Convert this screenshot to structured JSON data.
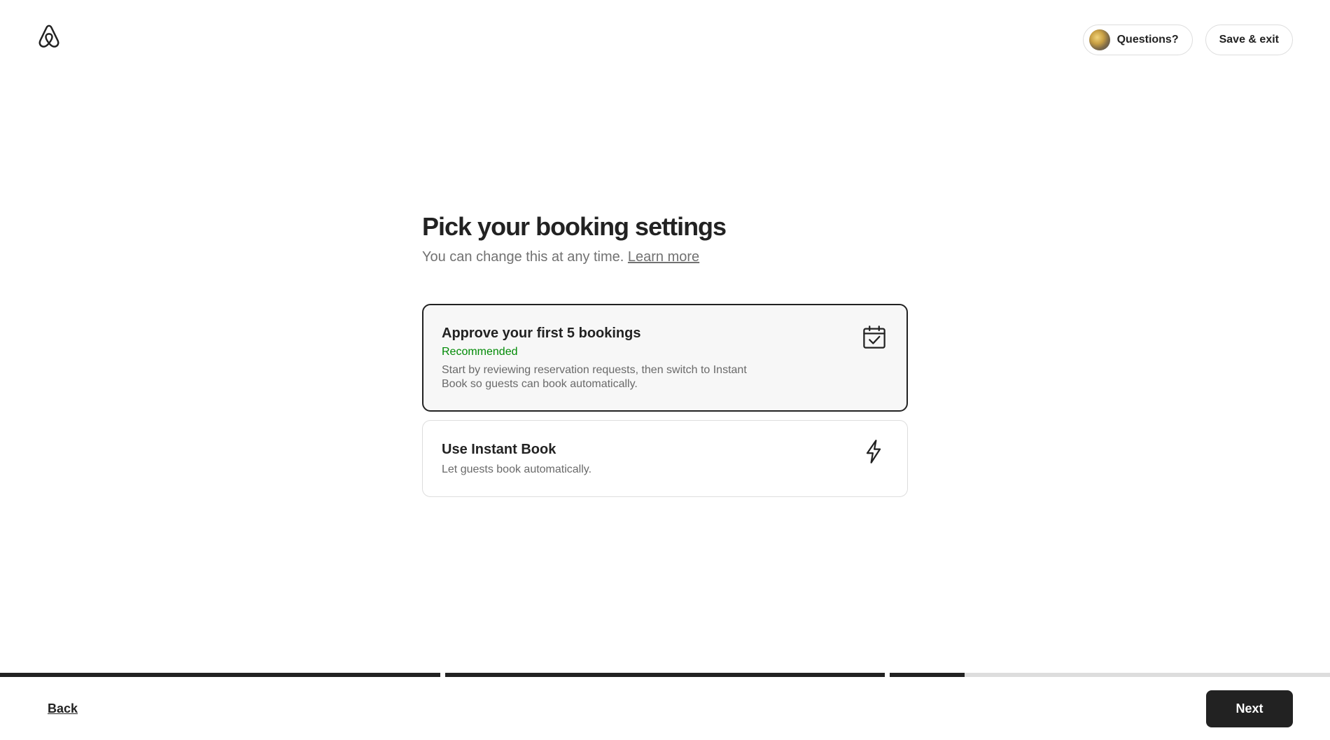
{
  "header": {
    "logo_icon": "airbnb-logo-icon",
    "questions_label": "Questions?",
    "save_exit_label": "Save & exit"
  },
  "main": {
    "title": "Pick your booking settings",
    "subtitle": "You can change this at any time.",
    "learn_more": "Learn more",
    "options": [
      {
        "title": "Approve your first 5 bookings",
        "tag": "Recommended",
        "description": "Start by reviewing reservation requests, then switch to Instant Book so guests can book automatically.",
        "icon": "calendar-check-icon",
        "selected": true
      },
      {
        "title": "Use Instant Book",
        "description": "Let guests book automatically.",
        "icon": "lightning-bolt-icon",
        "selected": false
      }
    ]
  },
  "progress": {
    "steps": 3,
    "step_fill": [
      1,
      1,
      0.17
    ]
  },
  "footer": {
    "back_label": "Back",
    "next_label": "Next"
  },
  "colors": {
    "primary": "#222222",
    "recommended": "#008a05",
    "muted_text": "#717171",
    "border": "#dddddd"
  }
}
